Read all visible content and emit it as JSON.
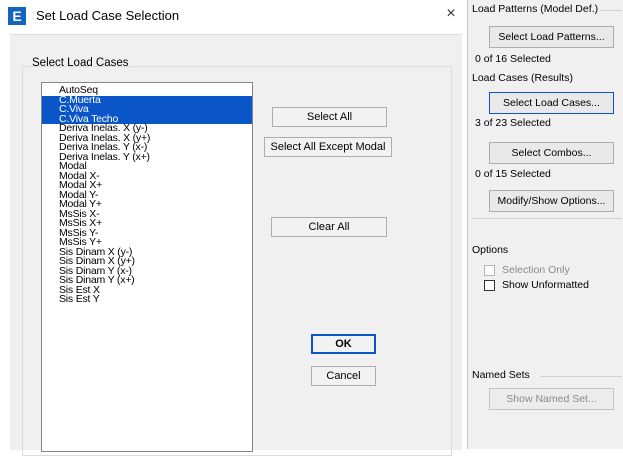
{
  "dialog": {
    "app_icon_letter": "E",
    "title": "Set Load Case Selection",
    "close_symbol": "×",
    "group_label": "Select Load Cases",
    "list_items": [
      {
        "label": "AutoSeq",
        "selected": false
      },
      {
        "label": "C.Muerta",
        "selected": true
      },
      {
        "label": "C.Viva",
        "selected": true
      },
      {
        "label": "C.Viva Techo",
        "selected": true
      },
      {
        "label": "Deriva Inelas. X (y-)",
        "selected": false
      },
      {
        "label": "Deriva Inelas. X (y+)",
        "selected": false
      },
      {
        "label": "Deriva Inelas. Y (x-)",
        "selected": false
      },
      {
        "label": "Deriva Inelas. Y (x+)",
        "selected": false
      },
      {
        "label": "Modal",
        "selected": false
      },
      {
        "label": "Modal X-",
        "selected": false
      },
      {
        "label": "Modal X+",
        "selected": false
      },
      {
        "label": "Modal Y-",
        "selected": false
      },
      {
        "label": "Modal Y+",
        "selected": false
      },
      {
        "label": "MsSis X-",
        "selected": false
      },
      {
        "label": "MsSis X+",
        "selected": false
      },
      {
        "label": "MsSis Y-",
        "selected": false
      },
      {
        "label": "MsSis Y+",
        "selected": false
      },
      {
        "label": "Sis Dinam X (y-)",
        "selected": false
      },
      {
        "label": "Sis Dinam X (y+)",
        "selected": false
      },
      {
        "label": "Sis Dinam Y (x-)",
        "selected": false
      },
      {
        "label": "Sis Dinam Y (x+)",
        "selected": false
      },
      {
        "label": "Sis Est X",
        "selected": false
      },
      {
        "label": "Sis Est Y",
        "selected": false
      }
    ],
    "buttons": {
      "select_all": "Select All",
      "select_all_except_modal": "Select All Except Modal",
      "clear_all": "Clear All",
      "ok": "OK",
      "cancel": "Cancel"
    }
  },
  "panel": {
    "load_patterns_label": "Load Patterns (Model Def.)",
    "select_load_patterns_button": "Select Load Patterns...",
    "load_patterns_count": "0 of 16 Selected",
    "load_cases_label": "Load Cases (Results)",
    "select_load_cases_button": "Select Load Cases...",
    "load_cases_count": "3 of 23 Selected",
    "select_combos_button": "Select Combos...",
    "combos_count": "0 of 15 Selected",
    "modify_show_options_button": "Modify/Show Options...",
    "options_label": "Options",
    "selection_only_label": "Selection Only",
    "show_unformatted_label": "Show Unformatted",
    "named_sets_label": "Named Sets",
    "show_named_set_button": "Show Named Set..."
  }
}
